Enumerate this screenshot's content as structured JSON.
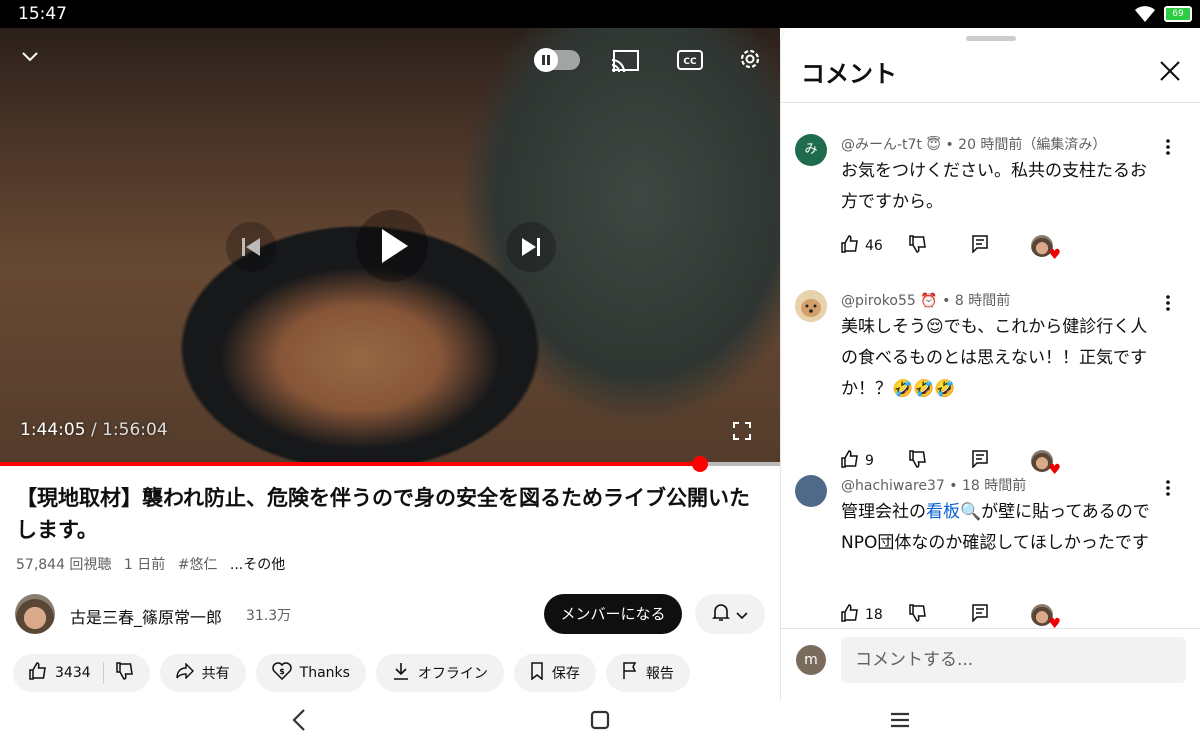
{
  "status_bar": {
    "time": "15:47",
    "battery": "69"
  },
  "video": {
    "current_time": "1:44:05",
    "separator": " / ",
    "duration": "1:56:04",
    "progress_fraction": 0.897
  },
  "title": "【現地取材】襲われ防止、危険を伴うので身の安全を図るためライブ公開いたします。",
  "meta": {
    "views": "57,844 回視聴",
    "age": "1 日前",
    "hashtag": "#悠仁",
    "more": "...その他"
  },
  "channel": {
    "name": "古是三春_篠原常一郎",
    "subscribers": "31.3万",
    "join_label": "メンバーになる"
  },
  "actions": {
    "like_count": "3434",
    "share": "共有",
    "thanks": "Thanks",
    "offline": "オフライン",
    "save": "保存",
    "report": "報告"
  },
  "comments_panel": {
    "title": "コメント",
    "input_placeholder": "コメントする...",
    "my_avatar_letter": "m",
    "comments": [
      {
        "avatar_letter": "み",
        "avatar_color": "#1e6b4e",
        "handle": "@みーん-t7t",
        "badge": "😇",
        "time": "• 20 時間前（編集済み）",
        "text": "お気をつけください。私共の支柱たるお方ですから。",
        "likes": "46"
      },
      {
        "avatar_letter": "",
        "avatar_color": "#e0c29a",
        "handle": "@piroko55",
        "badge": "⏰",
        "time": "• 8 時間前",
        "text": "美味しそう😌でも、これから健診行く人の食べるものとは思えない！！正気ですか！？🤣🤣🤣",
        "likes": "9"
      },
      {
        "avatar_letter": "",
        "avatar_color": "#4f6a88",
        "handle": "@hachiware37",
        "badge": "",
        "time": "• 18 時間前",
        "text_before": "管理会社の",
        "text_link": "看板🔍",
        "text_after": "が壁に貼ってあるのでNPO団体なのか確認してほしかったです",
        "likes": "18"
      }
    ]
  }
}
